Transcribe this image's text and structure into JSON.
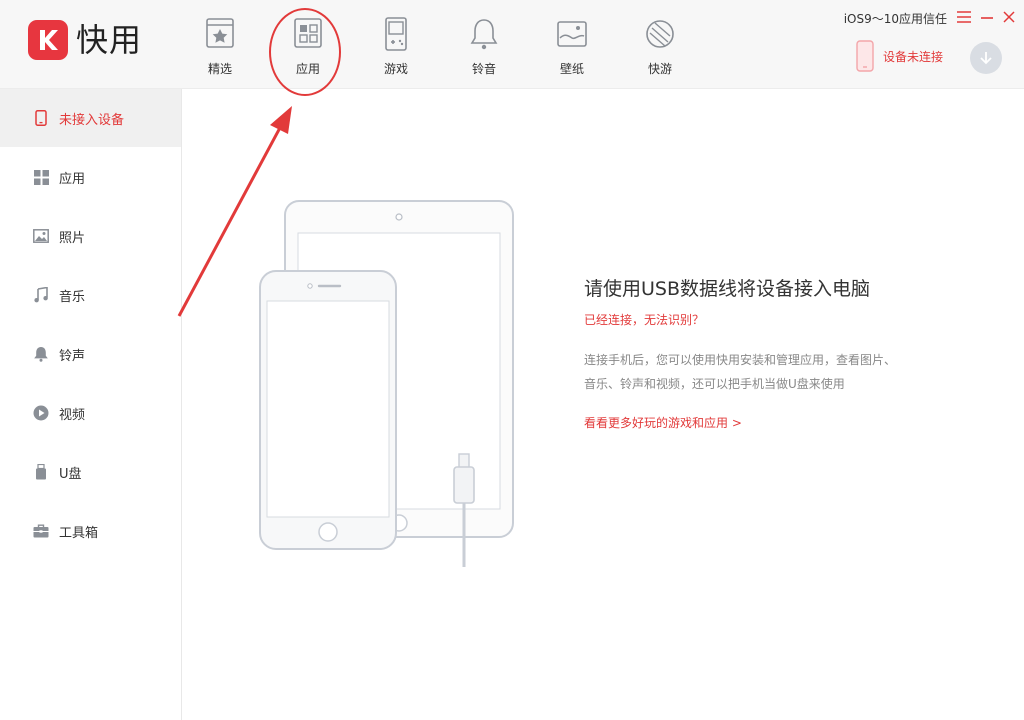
{
  "app": {
    "logo_letter": "K",
    "logo_text": "快用"
  },
  "nav": {
    "items": [
      {
        "label": "精选",
        "icon": "star-card-icon"
      },
      {
        "label": "应用",
        "icon": "apps-grid-icon"
      },
      {
        "label": "游戏",
        "icon": "gamepad-icon"
      },
      {
        "label": "铃音",
        "icon": "bell-icon"
      },
      {
        "label": "壁纸",
        "icon": "wallpaper-icon"
      },
      {
        "label": "快游",
        "icon": "fast-game-icon"
      }
    ]
  },
  "top_right": {
    "trust_text": "iOS9～10应用信任",
    "device_status": "设备未连接"
  },
  "sidebar": {
    "items": [
      {
        "label": "未接入设备",
        "icon": "phone-icon",
        "active": true
      },
      {
        "label": "应用",
        "icon": "apps-grid-icon"
      },
      {
        "label": "照片",
        "icon": "photo-icon"
      },
      {
        "label": "音乐",
        "icon": "music-note-icon"
      },
      {
        "label": "铃声",
        "icon": "bell-icon"
      },
      {
        "label": "视频",
        "icon": "play-circle-icon"
      },
      {
        "label": "U盘",
        "icon": "usb-drive-icon"
      },
      {
        "label": "工具箱",
        "icon": "toolbox-icon"
      }
    ]
  },
  "main": {
    "title": "请使用USB数据线将设备接入电脑",
    "link_connected": "已经连接，无法识别？",
    "description_line1": "连接手机后，您可以使用快用安装和管理应用，查看图片、",
    "description_line2": "音乐、铃声和视频，还可以把手机当做U盘来使用",
    "link_more": "看看更多好玩的游戏和应用 >"
  },
  "colors": {
    "accent": "#e23a3a",
    "logo_red": "#e7363f",
    "sidebar_active_bg": "#f0f0f0"
  }
}
